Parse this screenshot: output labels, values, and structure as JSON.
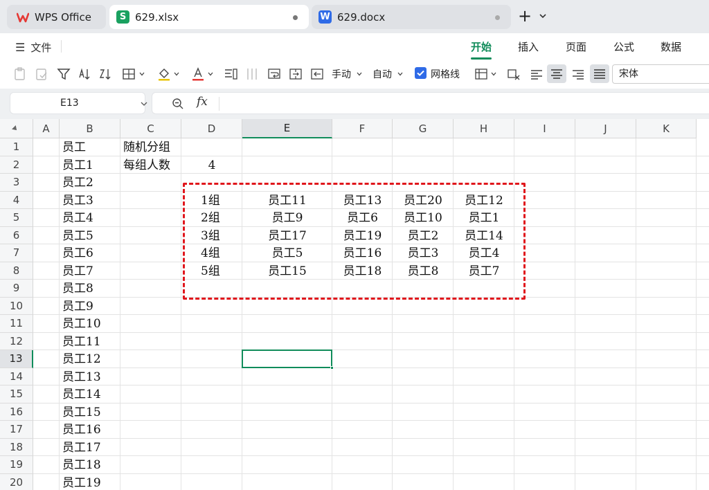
{
  "tabs": [
    {
      "label": "WPS Office"
    },
    {
      "label": "629.xlsx",
      "badge": "S"
    },
    {
      "label": "629.docx",
      "badge": "W"
    }
  ],
  "new_tab": "+",
  "menu": {
    "file": "文件",
    "tabs": [
      "开始",
      "插入",
      "页面",
      "公式",
      "数据"
    ]
  },
  "toolbar": {
    "row_height": "手动",
    "col_width": "自动",
    "gridlines": "网格线",
    "font": "宋体"
  },
  "formula_bar": {
    "cell_ref": "E13",
    "fx": "fx",
    "formula": ""
  },
  "grid": {
    "columns": [
      "A",
      "B",
      "C",
      "D",
      "E",
      "F",
      "G",
      "H",
      "I",
      "J",
      "K"
    ],
    "active_column": "E",
    "rows": [
      "1",
      "2",
      "3",
      "4",
      "5",
      "6",
      "7",
      "8",
      "9",
      "10",
      "11",
      "12",
      "13",
      "14",
      "15",
      "16",
      "17",
      "18",
      "19",
      "20"
    ],
    "active_row": "13",
    "colB": [
      "员工",
      "员工1",
      "员工2",
      "员工3",
      "员工4",
      "员工5",
      "员工6",
      "员工7",
      "员工8",
      "员工9",
      "员工10",
      "员工11",
      "员工12",
      "员工13",
      "员工14",
      "员工15",
      "员工16",
      "员工17",
      "员工18",
      "员工19"
    ],
    "C1": "随机分组",
    "C2": "每组人数",
    "D2": "4",
    "groups": [
      {
        "name": "1组",
        "E": "员工11",
        "F": "员工13",
        "G": "员工20",
        "H": "员工12"
      },
      {
        "name": "2组",
        "E": "员工9",
        "F": "员工6",
        "G": "员工10",
        "H": "员工1"
      },
      {
        "name": "3组",
        "E": "员工17",
        "F": "员工19",
        "G": "员工2",
        "H": "员工14"
      },
      {
        "name": "4组",
        "E": "员工5",
        "F": "员工16",
        "G": "员工3",
        "H": "员工4"
      },
      {
        "name": "5组",
        "E": "员工15",
        "F": "员工18",
        "G": "员工8",
        "H": "员工7"
      }
    ]
  },
  "colors": {
    "accent": "#108c5a",
    "highlight_border": "#e0161c"
  }
}
